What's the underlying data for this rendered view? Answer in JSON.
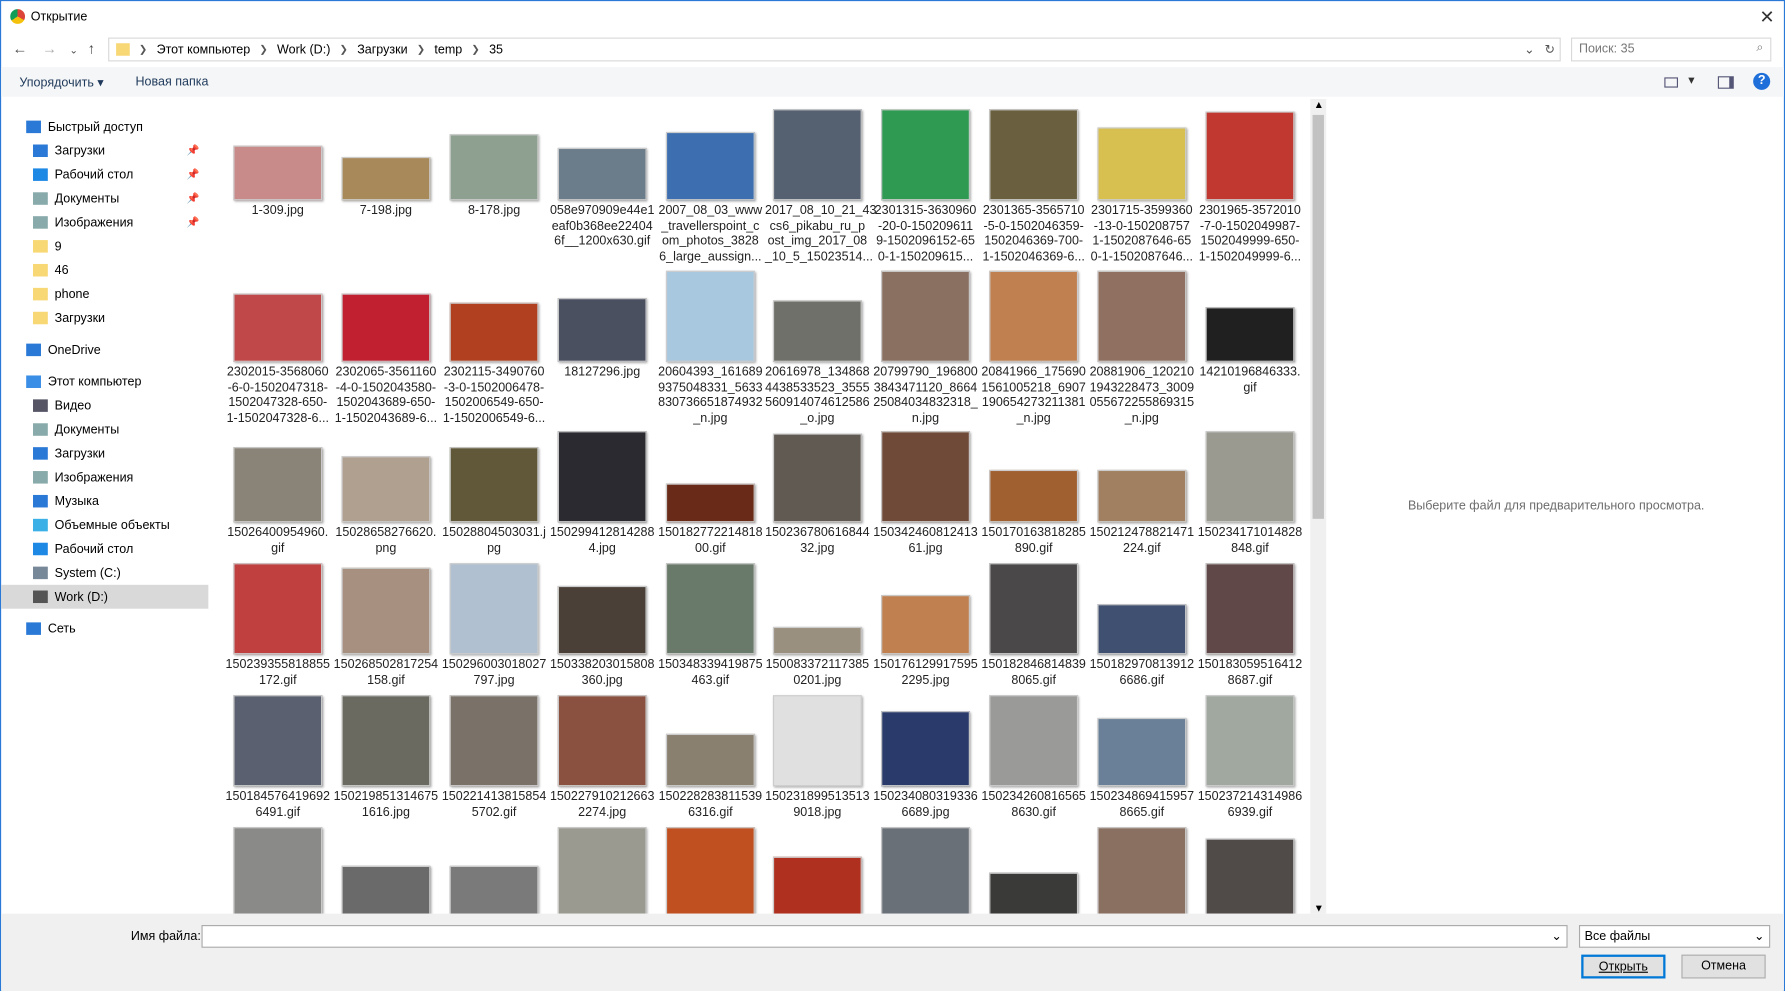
{
  "window": {
    "title": "Открытие",
    "close": "✕"
  },
  "address": {
    "crumbs": [
      "Этот компьютер",
      "Work (D:)",
      "Загрузки",
      "temp",
      "35"
    ],
    "search_placeholder": "Поиск: 35"
  },
  "toolbar": {
    "organize": "Упорядочить ▾",
    "new_folder": "Новая папка",
    "help": "?"
  },
  "sidebar": [
    {
      "label": "Быстрый доступ",
      "type": "top",
      "icon": "star-icon",
      "color": "#2b79d6"
    },
    {
      "label": "Загрузки",
      "icon": "download-icon",
      "color": "#2b79d6",
      "pin": true
    },
    {
      "label": "Рабочий стол",
      "icon": "desktop-icon",
      "color": "#1e88e5",
      "pin": true
    },
    {
      "label": "Документы",
      "icon": "documents-icon",
      "color": "#8aa",
      "pin": true
    },
    {
      "label": "Изображения",
      "icon": "pictures-icon",
      "color": "#8aa",
      "pin": true
    },
    {
      "label": "9",
      "icon": "folder-icon",
      "color": "#f8d775"
    },
    {
      "label": "46",
      "icon": "folder-icon",
      "color": "#f8d775"
    },
    {
      "label": "phone",
      "icon": "folder-icon",
      "color": "#f8d775"
    },
    {
      "label": "Загрузки",
      "icon": "folder-icon",
      "color": "#f8d775"
    },
    {
      "label": "OneDrive",
      "type": "top",
      "icon": "cloud-icon",
      "color": "#2b79d6"
    },
    {
      "label": "Этот компьютер",
      "type": "top",
      "icon": "computer-icon",
      "color": "#3a8ee6"
    },
    {
      "label": "Видео",
      "icon": "video-icon",
      "color": "#556"
    },
    {
      "label": "Документы",
      "icon": "documents-icon",
      "color": "#8aa"
    },
    {
      "label": "Загрузки",
      "icon": "download-icon",
      "color": "#2b79d6"
    },
    {
      "label": "Изображения",
      "icon": "pictures-icon",
      "color": "#8aa"
    },
    {
      "label": "Музыка",
      "icon": "music-icon",
      "color": "#2b79d6"
    },
    {
      "label": "Объемные объекты",
      "icon": "3d-objects-icon",
      "color": "#3ab0e6"
    },
    {
      "label": "Рабочий стол",
      "icon": "desktop-icon",
      "color": "#1e88e5"
    },
    {
      "label": "System (C:)",
      "icon": "drive-icon",
      "color": "#789"
    },
    {
      "label": "Work (D:)",
      "icon": "drive-icon",
      "color": "#555",
      "selected": true
    },
    {
      "label": "Сеть",
      "type": "top",
      "icon": "network-icon",
      "color": "#2b79d6"
    }
  ],
  "files": [
    "1-309.jpg",
    "7-198.jpg",
    "8-178.jpg",
    "058e970909e44e1\neaf0b368ee22404\n6f__1200x630.gif",
    "2007_08_03_www\n_travellerspoint_c\nom_photos_3828\n6_large_aussign...",
    "2017_08_10_21_43\ncs6_pikabu_ru_p\nost_img_2017_08\n_10_5_15023514...",
    "2301315-3630960\n-20-0-150209611\n9-1502096152-65\n0-1-150209615...",
    "2301365-3565710\n-5-0-1502046359-\n1502046369-700-\n1-1502046369-6...",
    "2301715-3599360\n-13-0-150208757\n1-1502087646-65\n0-1-1502087646...",
    "2301965-3572010\n-7-0-1502049987-\n1502049999-650-\n1-1502049999-6...",
    "2302015-3568060\n-6-0-1502047318-\n1502047328-650-\n1-1502047328-6...",
    "2302065-3561160\n-4-0-1502043580-\n1502043689-650-\n1-1502043689-6...",
    "2302115-3490760\n-3-0-1502006478-\n1502006549-650-\n1-1502006549-6...",
    "18127296.jpg",
    "20604393_161689\n9375048331_5633\n830736651874932\n_n.jpg",
    "20616978_134868\n4438533523_3555\n560914074612586\n_o.jpg",
    "20799790_196800\n3843471120_8664\n25084034832318_\nn.jpg",
    "20841966_175690\n1561005218_6907\n190654273211381\n_n.jpg",
    "20881906_120210\n1943228473_3009\n055672255869315\n_n.jpg",
    "14210196846333.\ngif",
    "15026400954960.\ngif",
    "15028658276620.\npng",
    "15028804503031.j\npg",
    "150299412814288\n4.jpg",
    "150182772214818\n00.gif",
    "150236780616844\n32.jpg",
    "150342460812413\n61.jpg",
    "150170163818285\n890.gif",
    "150212478821471\n224.gif",
    "150234171014828\n848.gif",
    "150239355818855\n172.gif",
    "150268502817254\n158.gif",
    "150296003018027\n797.jpg",
    "150338203015808\n360.jpg",
    "150348339419875\n463.gif",
    "150083372117385\n0201.jpg",
    "150176129917595\n2295.jpg",
    "150182846814839\n8065.gif",
    "150182970813912\n6686.gif",
    "150183059516412\n8687.gif",
    "150184576419692\n6491.gif",
    "150219851314675\n1616.jpg",
    "150221413815854\n5702.gif",
    "150227910212663\n2274.jpg",
    "150228283811539\n6316.gif",
    "150231899513513\n9018.jpg",
    "150234080319336\n6689.jpg",
    "150234260816565\n8630.gif",
    "150234869415957\n8665.gif",
    "150237214314986\n6939.gif",
    "",
    "",
    "",
    "",
    "",
    "",
    "",
    "",
    "",
    ""
  ],
  "preview": {
    "message": "Выберите файл для предварительного просмотра."
  },
  "bottom": {
    "filename_label": "Имя файла:",
    "filename_value": "",
    "filter": "Все файлы",
    "open": "Открыть",
    "cancel": "Отмена"
  }
}
